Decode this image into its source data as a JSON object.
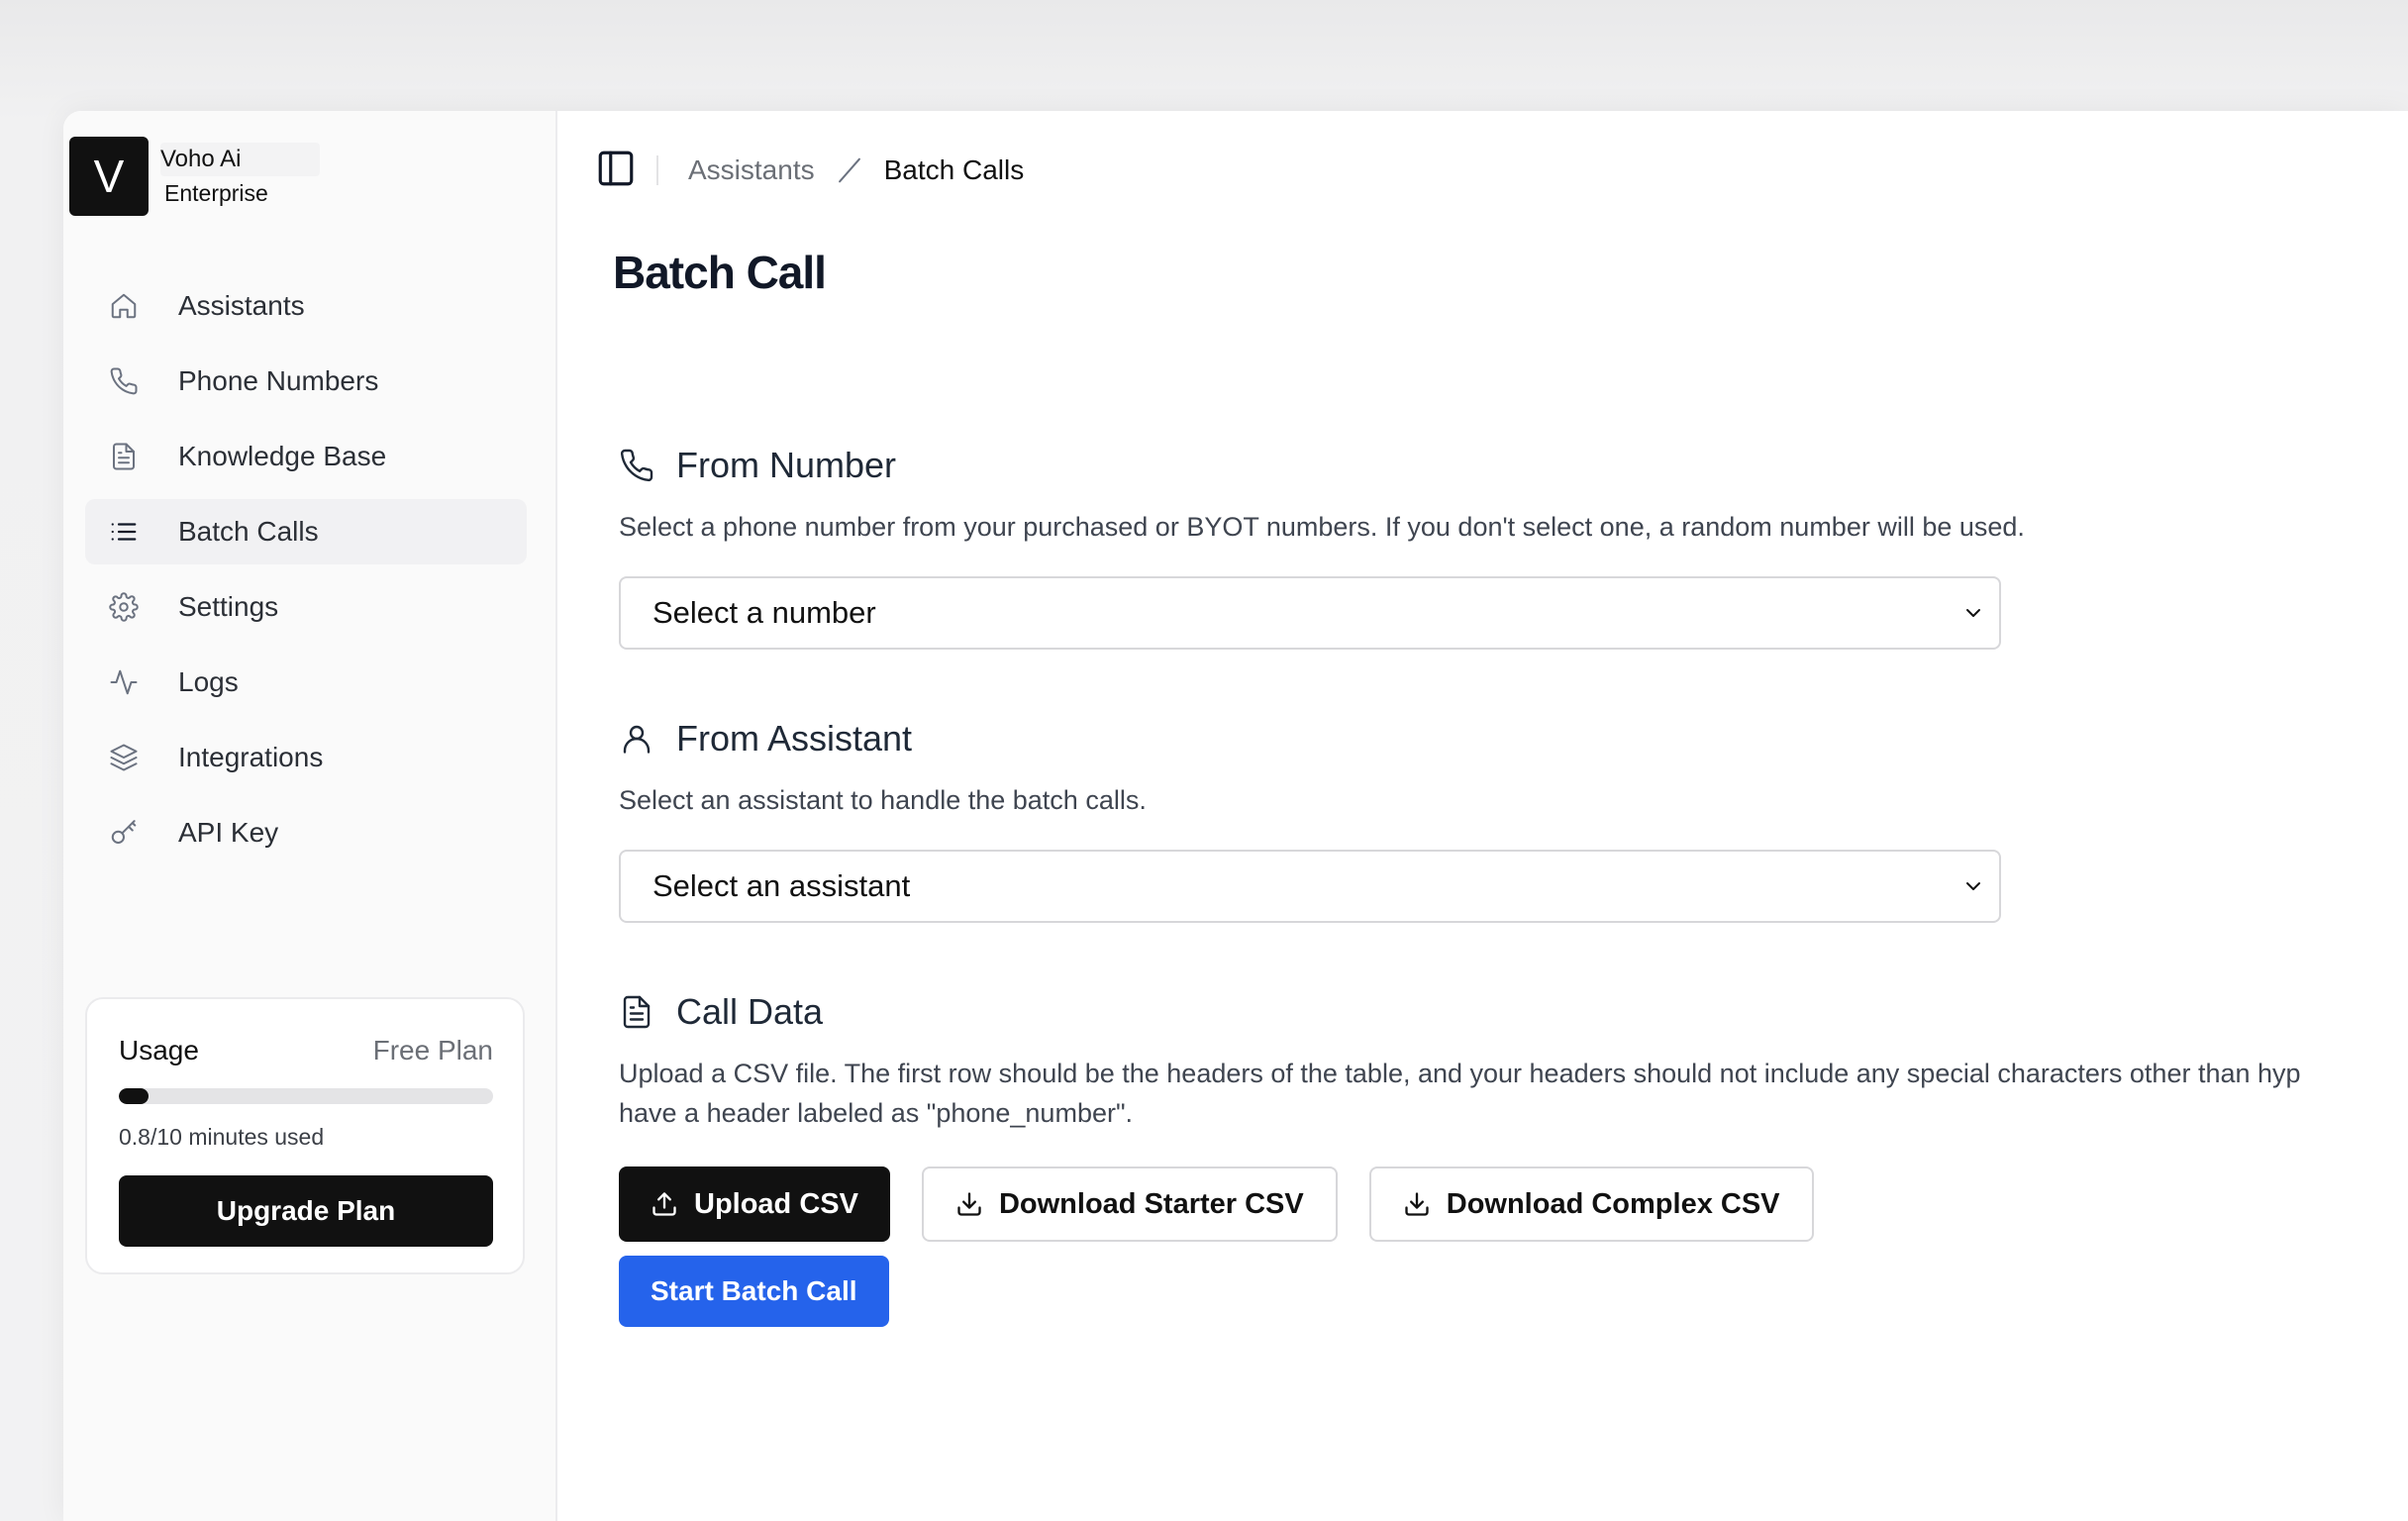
{
  "brand": {
    "logo_letter": "V",
    "name": "Voho Ai",
    "plan": "Enterprise"
  },
  "nav": {
    "items": [
      {
        "label": "Assistants",
        "icon": "home-icon"
      },
      {
        "label": "Phone Numbers",
        "icon": "phone-icon"
      },
      {
        "label": "Knowledge Base",
        "icon": "document-icon"
      },
      {
        "label": "Batch Calls",
        "icon": "list-icon",
        "active": true
      },
      {
        "label": "Settings",
        "icon": "gear-icon"
      },
      {
        "label": "Logs",
        "icon": "activity-icon"
      },
      {
        "label": "Integrations",
        "icon": "layers-icon"
      },
      {
        "label": "API Key",
        "icon": "key-icon"
      }
    ]
  },
  "usage": {
    "title": "Usage",
    "plan": "Free Plan",
    "used_minutes": 0.8,
    "total_minutes": 10,
    "text": "0.8/10 minutes used",
    "upgrade_label": "Upgrade Plan"
  },
  "breadcrumb": {
    "parent": "Assistants",
    "current": "Batch Calls"
  },
  "page": {
    "title": "Batch Call"
  },
  "from_number": {
    "title": "From Number",
    "description": "Select a phone number from your purchased or BYOT numbers. If you don't select one, a random number will be used.",
    "select_value": "Select a number"
  },
  "from_assistant": {
    "title": "From Assistant",
    "description": "Select an assistant to handle the batch calls.",
    "select_value": "Select an assistant"
  },
  "call_data": {
    "title": "Call Data",
    "description_line1": "Upload a CSV file. The first row should be the headers of the table, and your headers should not include any special characters other than hyp",
    "description_line2": "have a header labeled as \"phone_number\".",
    "upload_label": "Upload CSV",
    "download_starter_label": "Download Starter CSV",
    "download_complex_label": "Download Complex CSV"
  },
  "start_label": "Start Batch Call",
  "colors": {
    "primary": "#2563eb",
    "dark": "#111111",
    "sidebar_bg": "#fafafa"
  }
}
